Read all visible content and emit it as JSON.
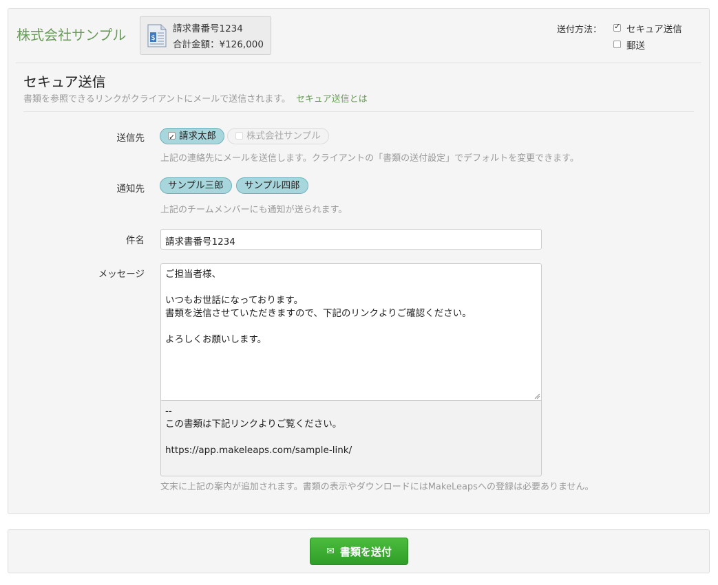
{
  "header": {
    "company": "株式会社サンプル",
    "doc_number": "請求書番号1234",
    "doc_total": "合計金額：¥126,000",
    "method_label": "送付方法：",
    "methods": [
      {
        "label": "セキュア送信",
        "checked": true
      },
      {
        "label": "郵送",
        "checked": false
      }
    ]
  },
  "section": {
    "title": "セキュア送信",
    "description": "書類を参照できるリンクがクライアントにメールで送信されます。",
    "link": "セキュア送信とは"
  },
  "form": {
    "recipients_label": "送信先",
    "recipients": [
      {
        "name": "請求太郎",
        "checked": true
      },
      {
        "name": "株式会社サンプル",
        "checked": false
      }
    ],
    "recipients_help": "上記の連絡先にメールを送信します。クライアントの「書類の送付設定」でデフォルトを変更できます。",
    "notify_label": "通知先",
    "notify": [
      "サンプル三郎",
      "サンプル四郎"
    ],
    "notify_help": "上記のチームメンバーにも通知が送られます。",
    "subject_label": "件名",
    "subject_value": "請求書番号1234",
    "message_label": "メッセージ",
    "message_lines": [
      "ご担当者様、",
      "",
      "いつもお世話になっております。",
      "書類を送信させていただきますので、下記のリンクよりご確認ください。",
      "",
      "よろしくお願いします。"
    ],
    "footer_lines": [
      "--",
      "この書類は下記リンクよりご覧ください。",
      "",
      "https://app.makeleaps.com/sample-link/"
    ],
    "footer_help": "文末に上記の案内が追加されます。書類の表示やダウンロードにはMakeLeapsへの登録は必要ありません。"
  },
  "actions": {
    "send_label": "書類を送付",
    "send_icon": "mail-icon"
  },
  "colors": {
    "brand_green": "#6a9a5a",
    "chip_bg": "#a8d6dd",
    "send_button": "#3aad32"
  }
}
